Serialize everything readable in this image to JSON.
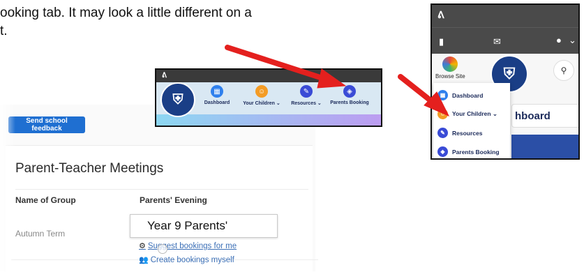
{
  "doc": {
    "line1": "ooking tab. It may look a little different on a",
    "line2": "t."
  },
  "booking_page": {
    "feedback_button": "Send school feedback",
    "panel_title": "Parent-Teacher Meetings",
    "col_group": "Name of Group",
    "col_evening": "Parents' Evening",
    "row_group": "Autumn Term",
    "row_evening": "Year 9 Parents'",
    "link_suggest": "Suggest bookings for me",
    "link_create": "Create bookings myself"
  },
  "navbar": {
    "items": [
      {
        "label": "Dashboard",
        "color": "#2f80ed",
        "icon": "grid-icon"
      },
      {
        "label": "Your Children ⌄",
        "color": "#f39c26",
        "icon": "children-icon"
      },
      {
        "label": "Resources ⌄",
        "color": "#3a4bd6",
        "icon": "resources-icon"
      },
      {
        "label": "Parents Booking",
        "color": "#3a4bd6",
        "icon": "tag-icon"
      }
    ]
  },
  "mobile": {
    "browse_label": "Browse Site",
    "dashboard_partial": "hboard",
    "menu": [
      {
        "label": "Dashboard",
        "color": "#2f80ed"
      },
      {
        "label": "Your Children ⌄",
        "color": "#f39c26"
      },
      {
        "label": "Resources",
        "color": "#3a4bd6"
      },
      {
        "label": "Parents Booking",
        "color": "#3a4bd6"
      }
    ]
  },
  "colors": {
    "arrow": "#e4201e",
    "accent": "#1f6fd1",
    "navy": "#1b2a5a"
  }
}
